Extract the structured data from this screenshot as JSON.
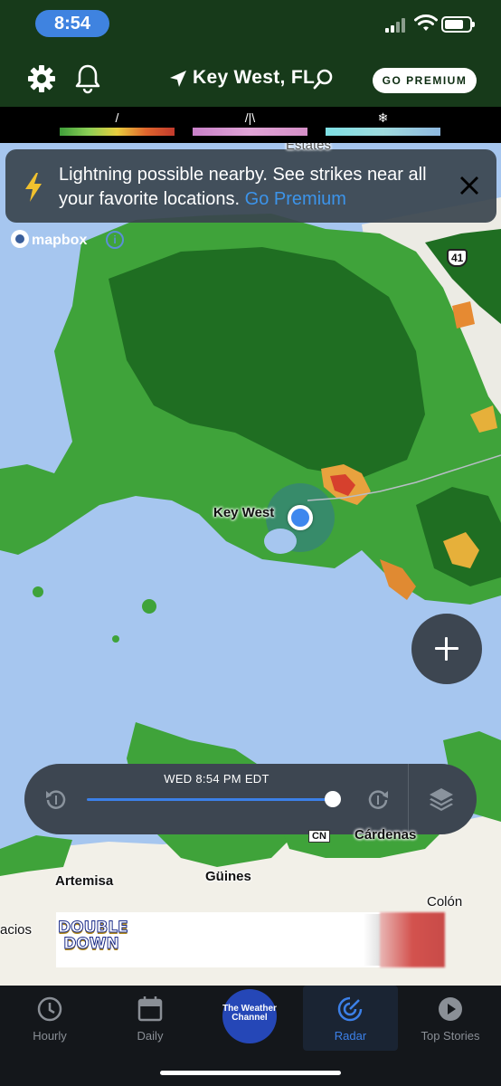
{
  "status_bar": {
    "time": "8:54"
  },
  "header": {
    "location": "Key West, FL",
    "premium_button": "GO PREMIUM"
  },
  "legend": [
    {
      "icon": "rain-icon",
      "symbol": "/",
      "colors": [
        "#3f9e3a",
        "#8bcf56",
        "#e8cd3e",
        "#e0662d",
        "#c23a2d"
      ]
    },
    {
      "icon": "mixed-icon",
      "symbol": "/|\\",
      "colors": [
        "#c981c9",
        "#e0a4d6",
        "#d58fc7"
      ]
    },
    {
      "icon": "snow-icon",
      "symbol": "❄",
      "colors": [
        "#7ee0e5",
        "#9fdadd",
        "#8fb9e0"
      ]
    }
  ],
  "alert": {
    "message": "Lightning possible nearby. See strikes near all your favorite locations.",
    "link": "Go Premium"
  },
  "map": {
    "attribution": "mapbox",
    "info": "i",
    "labels": {
      "estates": "Estates",
      "key_west": "Key West",
      "route": "41",
      "artemisa": "Artemisa",
      "guines": "Güines",
      "colon": "Colón",
      "cardenas": "Cárdenas",
      "highway": "CN",
      "acios": "acios"
    }
  },
  "timeline": {
    "timestamp": "WED 8:54 PM EDT",
    "progress": 0.97
  },
  "ad": {
    "brand": "DOUBLE DOWN"
  },
  "tabs": [
    {
      "label": "Hourly",
      "icon": "clock-icon"
    },
    {
      "label": "Daily",
      "icon": "calendar-icon"
    },
    {
      "label": "The Weather Channel",
      "icon": "twc-logo"
    },
    {
      "label": "Radar",
      "icon": "radar-icon",
      "active": true
    },
    {
      "label": "Top Stories",
      "icon": "play-icon"
    }
  ]
}
